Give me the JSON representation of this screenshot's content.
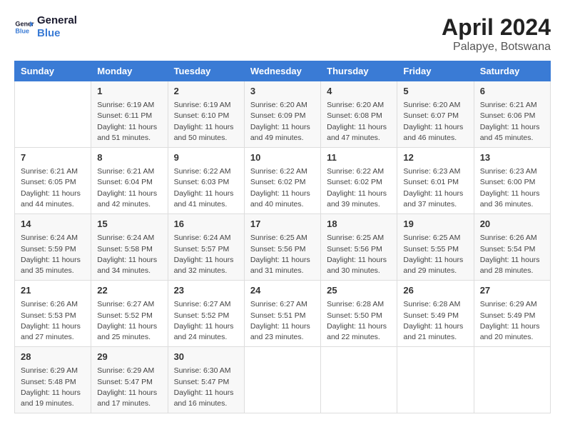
{
  "header": {
    "logo_line1": "General",
    "logo_line2": "Blue",
    "month": "April 2024",
    "location": "Palapye, Botswana"
  },
  "columns": [
    "Sunday",
    "Monday",
    "Tuesday",
    "Wednesday",
    "Thursday",
    "Friday",
    "Saturday"
  ],
  "weeks": [
    [
      {
        "day": "",
        "content": ""
      },
      {
        "day": "1",
        "content": "Sunrise: 6:19 AM\nSunset: 6:11 PM\nDaylight: 11 hours\nand 51 minutes."
      },
      {
        "day": "2",
        "content": "Sunrise: 6:19 AM\nSunset: 6:10 PM\nDaylight: 11 hours\nand 50 minutes."
      },
      {
        "day": "3",
        "content": "Sunrise: 6:20 AM\nSunset: 6:09 PM\nDaylight: 11 hours\nand 49 minutes."
      },
      {
        "day": "4",
        "content": "Sunrise: 6:20 AM\nSunset: 6:08 PM\nDaylight: 11 hours\nand 47 minutes."
      },
      {
        "day": "5",
        "content": "Sunrise: 6:20 AM\nSunset: 6:07 PM\nDaylight: 11 hours\nand 46 minutes."
      },
      {
        "day": "6",
        "content": "Sunrise: 6:21 AM\nSunset: 6:06 PM\nDaylight: 11 hours\nand 45 minutes."
      }
    ],
    [
      {
        "day": "7",
        "content": "Sunrise: 6:21 AM\nSunset: 6:05 PM\nDaylight: 11 hours\nand 44 minutes."
      },
      {
        "day": "8",
        "content": "Sunrise: 6:21 AM\nSunset: 6:04 PM\nDaylight: 11 hours\nand 42 minutes."
      },
      {
        "day": "9",
        "content": "Sunrise: 6:22 AM\nSunset: 6:03 PM\nDaylight: 11 hours\nand 41 minutes."
      },
      {
        "day": "10",
        "content": "Sunrise: 6:22 AM\nSunset: 6:02 PM\nDaylight: 11 hours\nand 40 minutes."
      },
      {
        "day": "11",
        "content": "Sunrise: 6:22 AM\nSunset: 6:02 PM\nDaylight: 11 hours\nand 39 minutes."
      },
      {
        "day": "12",
        "content": "Sunrise: 6:23 AM\nSunset: 6:01 PM\nDaylight: 11 hours\nand 37 minutes."
      },
      {
        "day": "13",
        "content": "Sunrise: 6:23 AM\nSunset: 6:00 PM\nDaylight: 11 hours\nand 36 minutes."
      }
    ],
    [
      {
        "day": "14",
        "content": "Sunrise: 6:24 AM\nSunset: 5:59 PM\nDaylight: 11 hours\nand 35 minutes."
      },
      {
        "day": "15",
        "content": "Sunrise: 6:24 AM\nSunset: 5:58 PM\nDaylight: 11 hours\nand 34 minutes."
      },
      {
        "day": "16",
        "content": "Sunrise: 6:24 AM\nSunset: 5:57 PM\nDaylight: 11 hours\nand 32 minutes."
      },
      {
        "day": "17",
        "content": "Sunrise: 6:25 AM\nSunset: 5:56 PM\nDaylight: 11 hours\nand 31 minutes."
      },
      {
        "day": "18",
        "content": "Sunrise: 6:25 AM\nSunset: 5:56 PM\nDaylight: 11 hours\nand 30 minutes."
      },
      {
        "day": "19",
        "content": "Sunrise: 6:25 AM\nSunset: 5:55 PM\nDaylight: 11 hours\nand 29 minutes."
      },
      {
        "day": "20",
        "content": "Sunrise: 6:26 AM\nSunset: 5:54 PM\nDaylight: 11 hours\nand 28 minutes."
      }
    ],
    [
      {
        "day": "21",
        "content": "Sunrise: 6:26 AM\nSunset: 5:53 PM\nDaylight: 11 hours\nand 27 minutes."
      },
      {
        "day": "22",
        "content": "Sunrise: 6:27 AM\nSunset: 5:52 PM\nDaylight: 11 hours\nand 25 minutes."
      },
      {
        "day": "23",
        "content": "Sunrise: 6:27 AM\nSunset: 5:52 PM\nDaylight: 11 hours\nand 24 minutes."
      },
      {
        "day": "24",
        "content": "Sunrise: 6:27 AM\nSunset: 5:51 PM\nDaylight: 11 hours\nand 23 minutes."
      },
      {
        "day": "25",
        "content": "Sunrise: 6:28 AM\nSunset: 5:50 PM\nDaylight: 11 hours\nand 22 minutes."
      },
      {
        "day": "26",
        "content": "Sunrise: 6:28 AM\nSunset: 5:49 PM\nDaylight: 11 hours\nand 21 minutes."
      },
      {
        "day": "27",
        "content": "Sunrise: 6:29 AM\nSunset: 5:49 PM\nDaylight: 11 hours\nand 20 minutes."
      }
    ],
    [
      {
        "day": "28",
        "content": "Sunrise: 6:29 AM\nSunset: 5:48 PM\nDaylight: 11 hours\nand 19 minutes."
      },
      {
        "day": "29",
        "content": "Sunrise: 6:29 AM\nSunset: 5:47 PM\nDaylight: 11 hours\nand 17 minutes."
      },
      {
        "day": "30",
        "content": "Sunrise: 6:30 AM\nSunset: 5:47 PM\nDaylight: 11 hours\nand 16 minutes."
      },
      {
        "day": "",
        "content": ""
      },
      {
        "day": "",
        "content": ""
      },
      {
        "day": "",
        "content": ""
      },
      {
        "day": "",
        "content": ""
      }
    ]
  ]
}
